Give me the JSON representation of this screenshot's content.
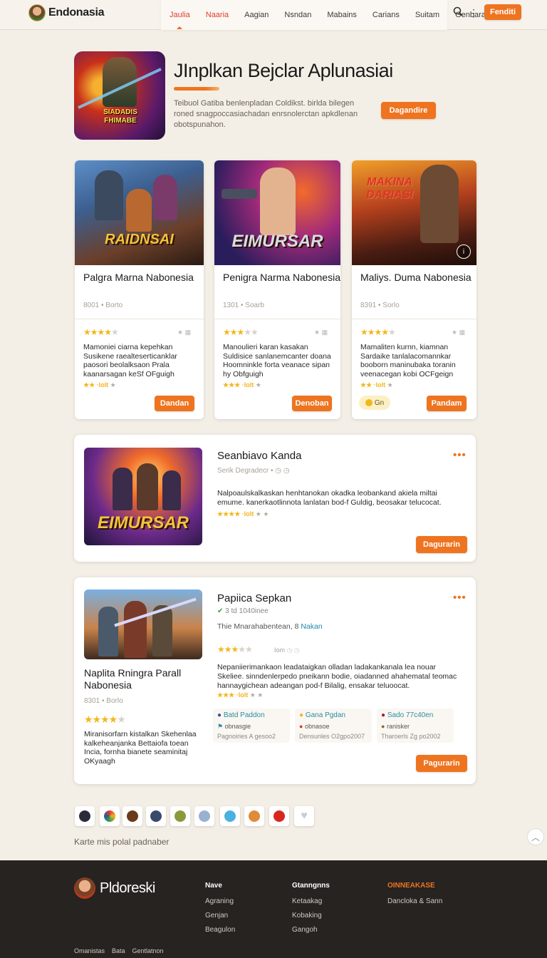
{
  "nav": {
    "brand": "Endonasia",
    "tabs": [
      "Jaulia",
      "Naaria",
      "Aagian",
      "Nsndan",
      "Mabains",
      "Carians",
      "Suitam",
      "Genbara"
    ],
    "cta": "Fenditi"
  },
  "hero": {
    "art_title": "SIADADIS FHIMABE",
    "title": "JInplkan Bejclar Aplunasiai",
    "description": "Teibuol Gatiba benlenpladan Coldikst. birlda bilegen roned snagpoccasiachadan enrsnolerctan apkdlenan obotspunahon.",
    "button": "Dagandire"
  },
  "cards": [
    {
      "art_title": "RAIDNSAI",
      "title": "Palgra Marna Nabonesia",
      "meta": "8001 • Borto",
      "stars": 4,
      "text": "Mamoniei ciarna kepehkan Susikene raealteserticanklar paosori beolalksaon Prala kaanarsagan keSf OFguigh",
      "mini_rating": "★★ ·Iolt",
      "button": "Dandan"
    },
    {
      "art_title": "EIMURSAR",
      "title": "Penigra Narma Nabonesia",
      "meta": "1301 • Soarb",
      "stars": 3,
      "text": "Manoulieri karan kasakan Suldisice sanlanemcanter doana Hoomninkle forta veanace sipan hy Obfguigh",
      "mini_rating": "★★★ ·Iolt",
      "button": "Denoban"
    },
    {
      "art_title": "MAKINA DARIASI",
      "title": "Maliys. Duma Nabonesia",
      "meta": "8391 • Sorlo",
      "stars": 4,
      "text": "Mamaliten kurnn, kiamnan Sardaike tanlalacomannkar booborn maninubaka toranin veenacegan kobi OCFgeign",
      "mini_rating": "★★ ·Iolt",
      "coin": "Gn",
      "button": "Pandam"
    }
  ],
  "wide1": {
    "art_title": "EIMURSAR",
    "title": "Seanbiavo Kanda",
    "meta": "Serik Degradecr • ◷ ◷",
    "text": "Nalpoaulskalkaskan henhtanokan okadka leobankand akiela miltai emume. kanerkaotlinnota lanlatan bod-f Guldig, beosakar telucocat.",
    "mini_rating": "★★★★ ·Iolt",
    "button": "Dagurarin"
  },
  "wide2": {
    "title": "Papiica Sepkan",
    "verified": "3 td 1040inee",
    "subline": "Thie Mnarahabentean, 8",
    "subline_link": "Nakan",
    "meta": "Iom",
    "stars": 3,
    "left_title": "Naplita Rningra Parall Nabonesia",
    "left_meta": "8301 • Borlo",
    "left_stars": 4,
    "left_text": "Miranisorfarn kistalkan Skehenlaa kalkeheanjanka Bettaiofa toean Incia, fornha bianete seaminitaj OKyaagh",
    "text": "Nepaniierimankaon leadataigkan olladan ladakankanala lea nouar Skeliee. sinndenlerpedo pneikann bodie, oiadanned ahahematal teomac hannaygichean adeangan pod-f Bilalig, ensakar teluoocat.",
    "mini_rating": "★★★ ·Iolt",
    "subcards": [
      {
        "title": "Batd Paddon",
        "meta": "obnasgie",
        "bottom": "Pagnoiries A gesoo2"
      },
      {
        "title": "Gana Pgdan",
        "meta": "obnasoe",
        "bottom": "Densunles O2gpo2007"
      },
      {
        "title": "Sado 77c40en",
        "meta": "ranisker",
        "bottom": "Tharoerls Zg po2002"
      }
    ],
    "button": "Pagurarin"
  },
  "tagline": "Karte mis polal padnaber",
  "footer": {
    "brand": "Pldoreski",
    "columns": [
      {
        "heading": "Nave",
        "links": [
          "Agraning",
          "Genjan",
          "Beagulon"
        ]
      },
      {
        "heading": "Gtanngnns",
        "links": [
          "Ketaakag",
          "Kobaking",
          "Gangoh"
        ]
      },
      {
        "heading": "OINNEAKASE",
        "links": [
          "Dancloka & Sann"
        ]
      }
    ],
    "bottom_links": [
      "Omanistas",
      "Bata",
      "Gentlatnon"
    ]
  },
  "colors": {
    "accent": "#ee7420",
    "star": "#f3b71a",
    "footer_bg": "#262321"
  }
}
